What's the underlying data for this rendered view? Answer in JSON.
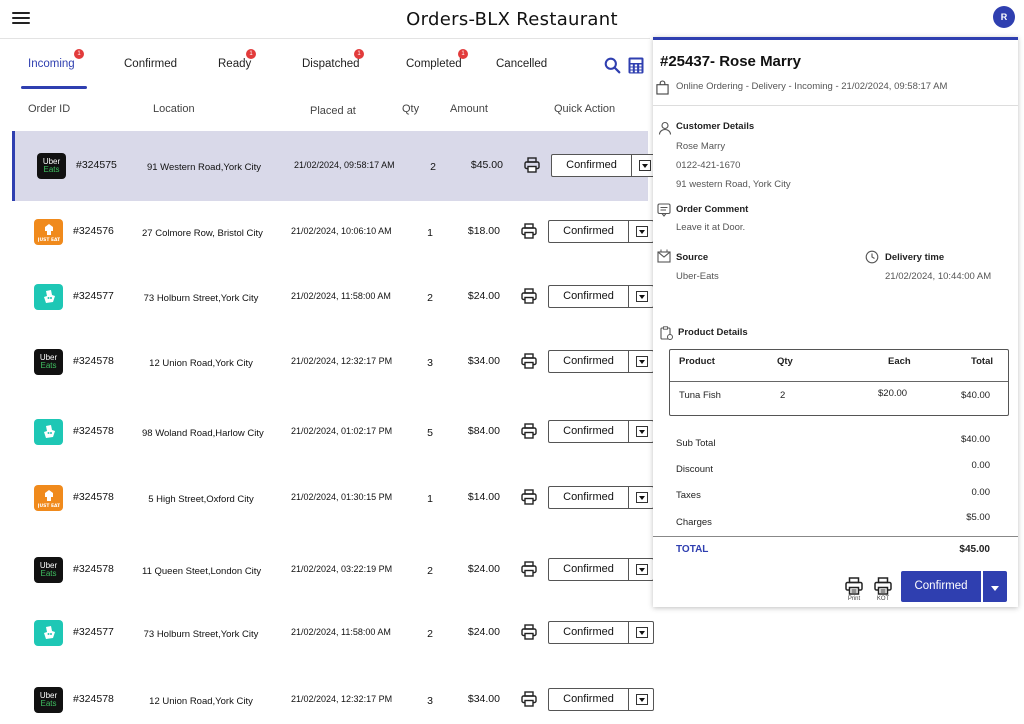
{
  "header": {
    "title": "Orders-BLX Restaurant",
    "avatar_initial": "R"
  },
  "tabs": [
    {
      "label": "Incoming",
      "badge": "1",
      "active": true
    },
    {
      "label": "Confirmed"
    },
    {
      "label": "Ready",
      "badge": "1"
    },
    {
      "label": "Dispatched",
      "badge": "1"
    },
    {
      "label": "Completed",
      "badge": "1"
    },
    {
      "label": "Cancelled"
    }
  ],
  "columns": {
    "order_id": "Order ID",
    "location": "Location",
    "placed_at": "Placed at",
    "qty": "Qty",
    "amount": "Amount",
    "quick_action": "Quick Action"
  },
  "orders": [
    {
      "source": "uber",
      "id": "#324575",
      "location": "91 Western Road,York City",
      "placed": "21/02/2024, 09:58:17 AM",
      "qty": "2",
      "amount": "$45.00",
      "action": "Confirmed"
    },
    {
      "source": "just",
      "id": "#324576",
      "location": "27 Colmore Row, Bristol City",
      "placed": "21/02/2024, 10:06:10 AM",
      "qty": "1",
      "amount": "$18.00",
      "action": "Confirmed"
    },
    {
      "source": "deliv",
      "id": "#324577",
      "location": "73 Holburn Street,York City",
      "placed": "21/02/2024, 11:58:00 AM",
      "qty": "2",
      "amount": "$24.00",
      "action": "Confirmed"
    },
    {
      "source": "uber",
      "id": "#324578",
      "location": "12 Union Road,York City",
      "placed": "21/02/2024, 12:32:17 PM",
      "qty": "3",
      "amount": "$34.00",
      "action": "Confirmed"
    },
    {
      "source": "deliv",
      "id": "#324578",
      "location": "98 Woland Road,Harlow City",
      "placed": "21/02/2024, 01:02:17 PM",
      "qty": "5",
      "amount": "$84.00",
      "action": "Confirmed"
    },
    {
      "source": "just",
      "id": "#324578",
      "location": "5 High Street,Oxford City",
      "placed": "21/02/2024, 01:30:15 PM",
      "qty": "1",
      "amount": "$14.00",
      "action": "Confirmed"
    },
    {
      "source": "uber",
      "id": "#324578",
      "location": "11 Queen Steet,London City",
      "placed": "21/02/2024, 03:22:19 PM",
      "qty": "2",
      "amount": "$24.00",
      "action": "Confirmed"
    },
    {
      "source": "deliv",
      "id": "#324577",
      "location": "73 Holburn Street,York City",
      "placed": "21/02/2024, 11:58:00 AM",
      "qty": "2",
      "amount": "$24.00",
      "action": "Confirmed"
    },
    {
      "source": "uber",
      "id": "#324578",
      "location": "12 Union Road,York City",
      "placed": "21/02/2024, 12:32:17 PM",
      "qty": "3",
      "amount": "$34.00",
      "action": "Confirmed"
    }
  ],
  "logos": {
    "uber_line1": "Uber",
    "uber_line2": "Eats",
    "just_text": "JUST EAT"
  },
  "detail": {
    "title": "#25437- Rose Marry",
    "subtitle": "Online Ordering - Delivery - Incoming - 21/02/2024, 09:58:17 AM",
    "customer_label": "Customer Details",
    "customer_name": "Rose Marry",
    "customer_phone": "0122-421-1670",
    "customer_address": "91 western Road, York City",
    "comment_label": "Order Comment",
    "comment": "Leave it at Door.",
    "source_label": "Source",
    "source": "Uber-Eats",
    "delivery_label": "Delivery time",
    "delivery_time": "21/02/2024, 10:44:00 AM",
    "products_label": "Product Details",
    "product_headers": {
      "product": "Product",
      "qty": "Qty",
      "each": "Each",
      "total": "Total"
    },
    "products": [
      {
        "name": "Tuna Fish",
        "qty": "2",
        "each": "$20.00",
        "total": "$40.00"
      }
    ],
    "summary": {
      "subtotal_label": "Sub Total",
      "subtotal": "$40.00",
      "discount_label": "Discount",
      "discount": "0.00",
      "taxes_label": "Taxes",
      "taxes": "0.00",
      "charges_label": "Charges",
      "charges": "$5.00",
      "total_label": "TOTAL",
      "total": "$45.00"
    },
    "print_caption": "Print",
    "kot_caption": "KOT",
    "confirm_button": "Confirmed"
  },
  "colors": {
    "accent": "#2f3fb0",
    "badge": "#e23b3b",
    "selected_row": "#d9d9e9",
    "uber_bg": "#111111",
    "justeat_bg": "#f08a1c",
    "deliveroo_bg": "#1ec7b5"
  }
}
